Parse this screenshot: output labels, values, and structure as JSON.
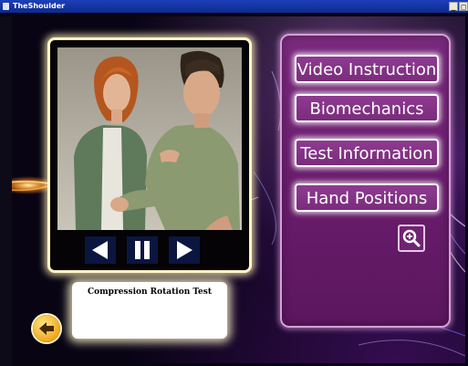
{
  "window": {
    "title": "TheShoulder",
    "controls": [
      "_",
      "□"
    ],
    "app_icon": "app-icon"
  },
  "video": {
    "controls": [
      {
        "name": "previous",
        "icon": "triangle-left-icon"
      },
      {
        "name": "pause",
        "icon": "pause-icon"
      },
      {
        "name": "next",
        "icon": "triangle-right-icon"
      }
    ]
  },
  "caption": {
    "text": "Compression Rotation Test"
  },
  "back_button": {
    "icon": "arrow-left-icon",
    "color": "#f1a51b"
  },
  "menu": {
    "items": [
      {
        "label": "Video Instruction"
      },
      {
        "label": "Biomechanics"
      },
      {
        "label": "Test Information"
      },
      {
        "label": "Hand Positions"
      }
    ],
    "zoom_icon": "magnifier-plus-icon",
    "accent": "#7a2a7e"
  }
}
